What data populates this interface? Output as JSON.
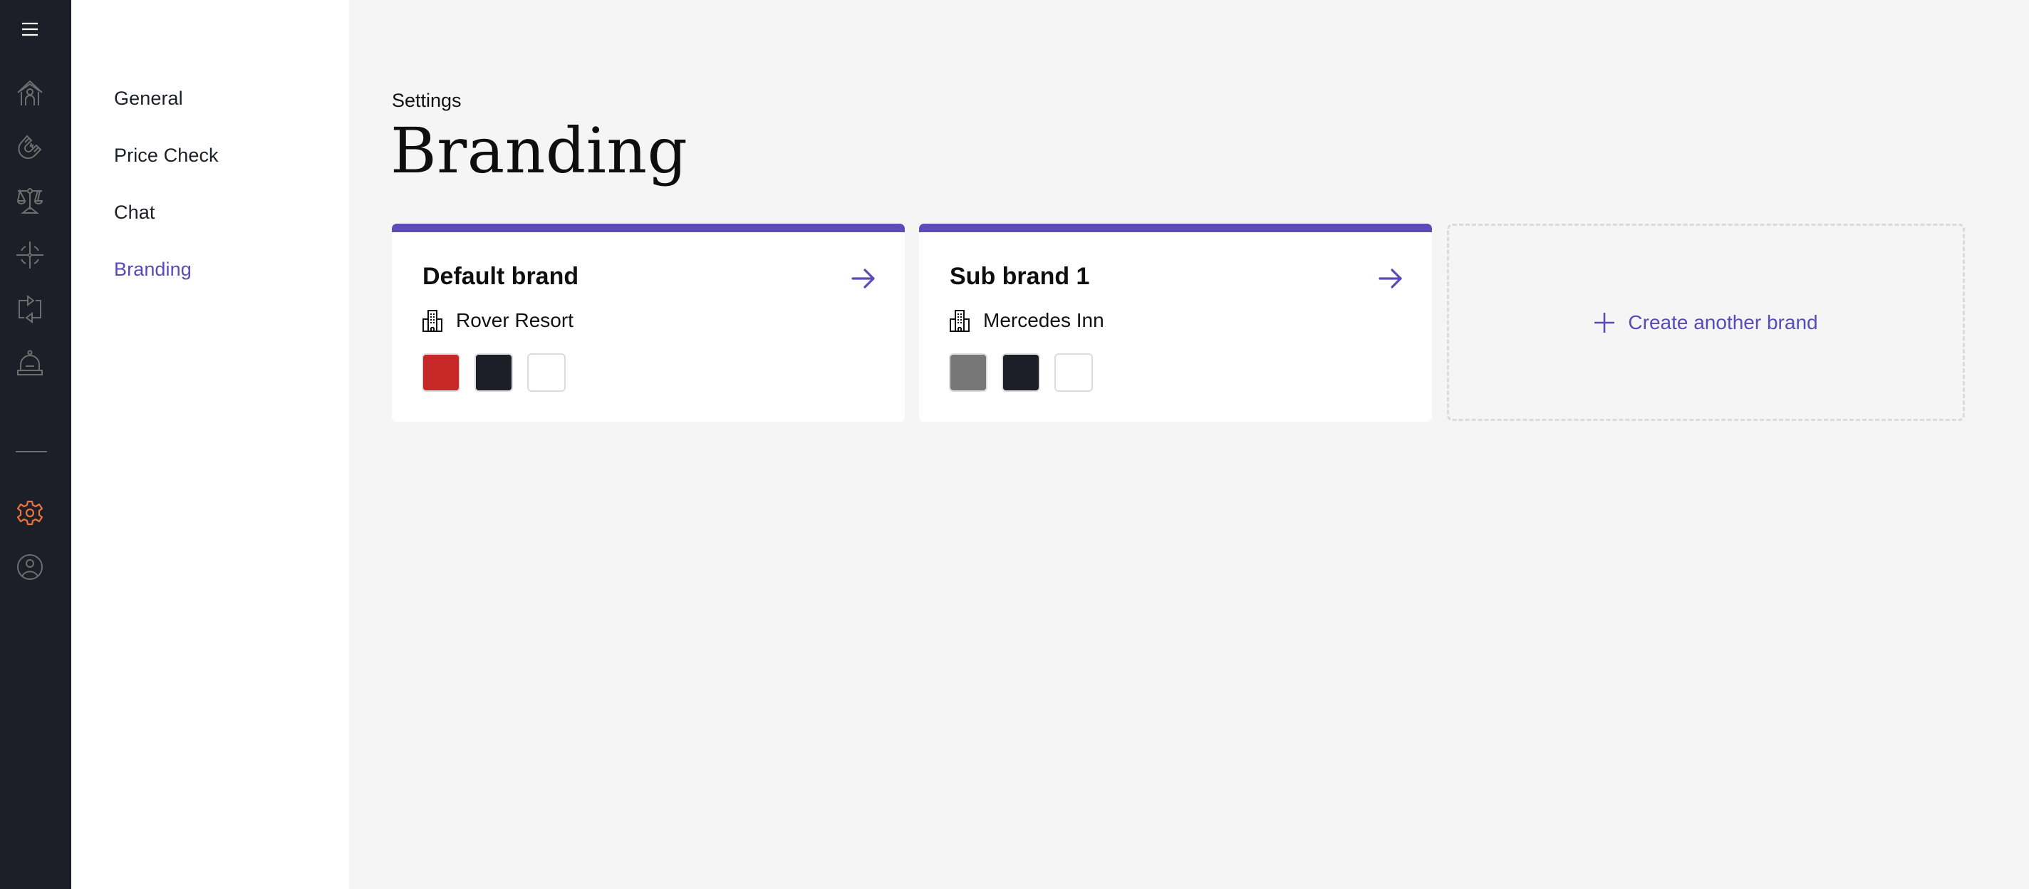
{
  "rail": {
    "items": [
      {
        "icon": "menu-icon",
        "label": "Menu"
      },
      {
        "icon": "home-person-icon",
        "label": "Home"
      },
      {
        "icon": "magnet-icon",
        "label": "Attract"
      },
      {
        "icon": "scale-icon",
        "label": "Compare"
      },
      {
        "icon": "target-icon",
        "label": "Target"
      },
      {
        "icon": "repeat-icon",
        "label": "Sync"
      },
      {
        "icon": "bell-icon",
        "label": "Service"
      },
      {
        "icon": "gear-icon",
        "label": "Settings",
        "active": true
      },
      {
        "icon": "user-circle-icon",
        "label": "Profile"
      }
    ],
    "active_color": "#E8743B",
    "icon_color": "#6E6E6E"
  },
  "subnav": {
    "items": [
      {
        "label": "General",
        "active": false
      },
      {
        "label": "Price Check",
        "active": false
      },
      {
        "label": "Chat",
        "active": false
      },
      {
        "label": "Branding",
        "active": true
      }
    ]
  },
  "header": {
    "eyebrow": "Settings",
    "title": "Branding"
  },
  "brands": [
    {
      "name": "Default brand",
      "hotel": "Rover Resort",
      "colors": [
        "#C62828",
        "#1C1F27",
        "#FFFFFF"
      ]
    },
    {
      "name": "Sub brand 1",
      "hotel": "Mercedes Inn",
      "colors": [
        "#777777",
        "#1C1F27",
        "#FFFFFF"
      ]
    }
  ],
  "create_brand": {
    "label": "Create another brand",
    "icon": "plus-icon"
  },
  "theme": {
    "accent": "#584BB8",
    "background": "#F5F5F5",
    "rail_background": "#1C1F27"
  }
}
